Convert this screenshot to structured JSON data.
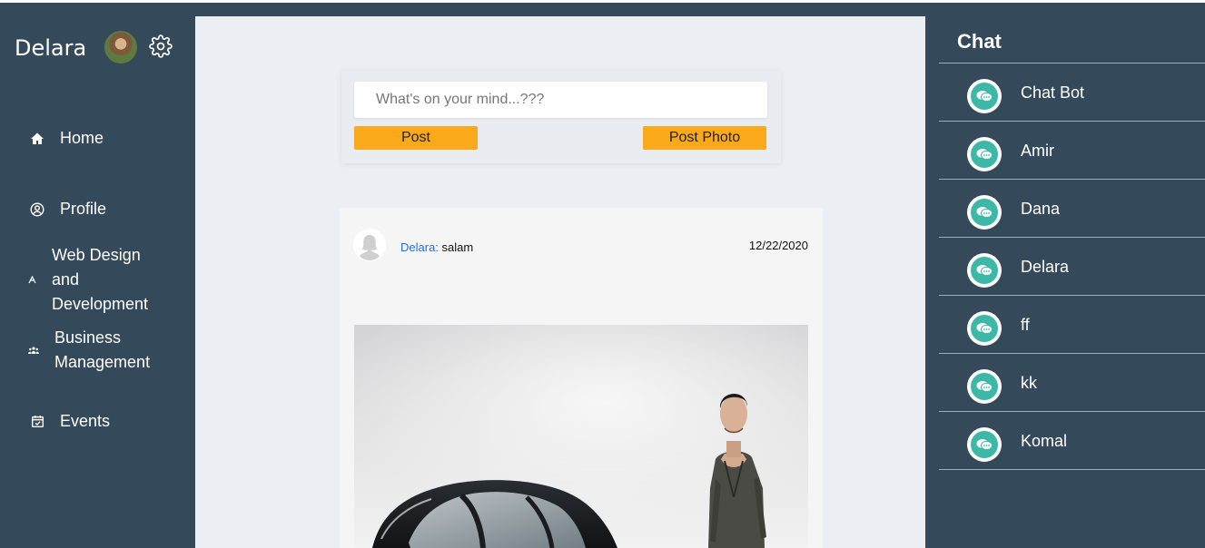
{
  "sidebar": {
    "username": "Delara",
    "nav": [
      {
        "label": "Home",
        "icon": "home-icon"
      },
      {
        "label": "Profile",
        "icon": "user-circle-icon"
      },
      {
        "label": "Web Design and Development",
        "lines": [
          "Web Design",
          "and",
          "Development"
        ],
        "icon": "design-icon"
      },
      {
        "label": "Business Management",
        "lines": [
          "Business",
          "Management"
        ],
        "icon": "group-icon"
      },
      {
        "label": "Events",
        "icon": "calendar-check-icon"
      }
    ]
  },
  "composer": {
    "placeholder": "What's on your mind...???",
    "post_label": "Post",
    "post_photo_label": "Post Photo"
  },
  "post": {
    "author": "Delara:",
    "text": "salam",
    "date": "12/22/2020"
  },
  "chat": {
    "title": "Chat",
    "contacts": [
      "Chat Bot",
      "Amir",
      "Dana",
      "Delara",
      "ff",
      "kk",
      "Komal"
    ]
  },
  "colors": {
    "sidebar_bg": "#34495a",
    "main_bg": "#ebeff3",
    "button": "#f9a919",
    "chat_icon": "#3db8a7",
    "author_link": "#1a73e8"
  }
}
